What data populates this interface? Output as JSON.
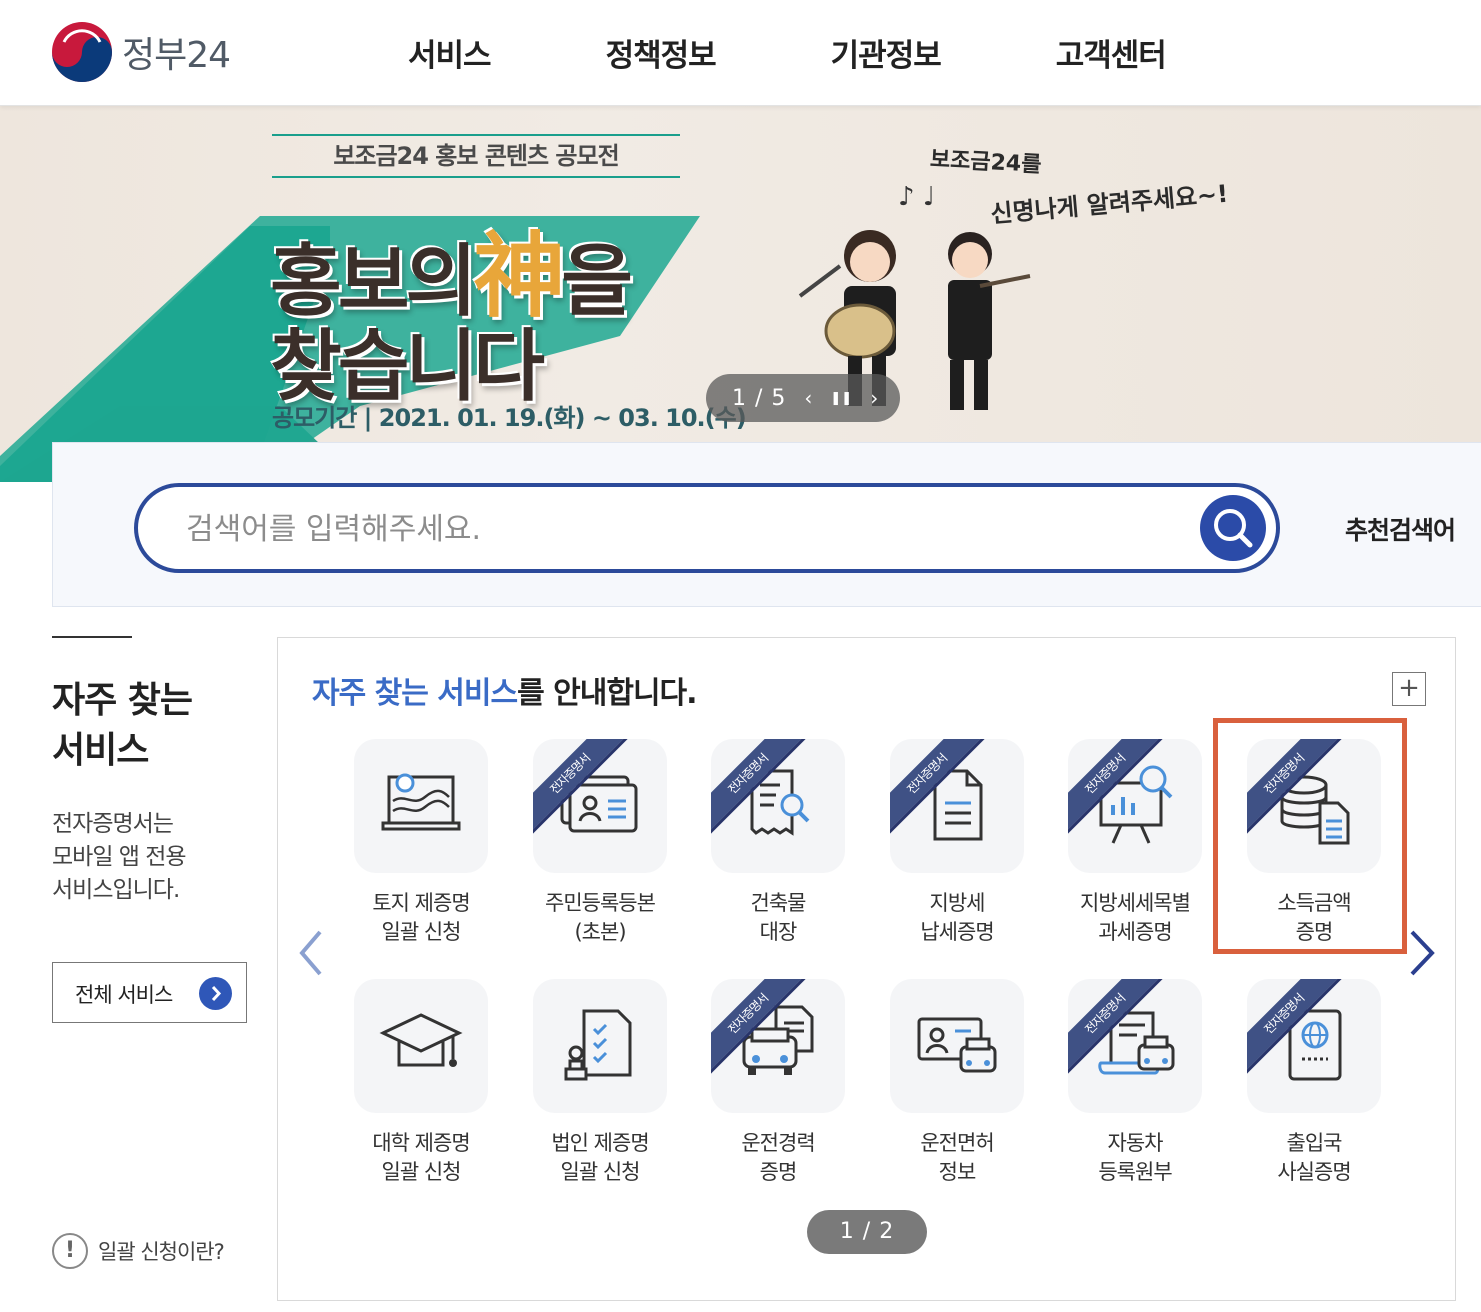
{
  "header": {
    "logo_text": "정부24",
    "nav": [
      "서비스",
      "정책정보",
      "기관정보",
      "고객센터"
    ]
  },
  "banner": {
    "subtitle": "보조금24 홍보 콘텐츠 공모전",
    "title_line1_a": "홍보의",
    "title_line1_god": "神",
    "title_line1_b": "을",
    "title_line2": "찾습니다",
    "period": "공모기간 | 2021. 01. 19.(화) ~ 03. 10.(수)",
    "tag_line1": "보조금24를",
    "tag_line2": "신명나게 알려주세요~!",
    "slide_counter": "1 / 5",
    "prev_glyph": "‹",
    "pause_glyph": "❚❚",
    "next_glyph": "›"
  },
  "search": {
    "placeholder": "검색어를 입력해주세요.",
    "recommend_label": "추천검색어"
  },
  "left": {
    "title_line1": "자주 찾는",
    "title_line2": "서비스",
    "desc_line1": "전자증명서는",
    "desc_line2": "모바일 앱 전용",
    "desc_line3": "서비스입니다.",
    "all_service_label": "전체 서비스",
    "batch_info_label": "일괄 신청이란?",
    "batch_info_glyph": "!"
  },
  "panel": {
    "title_highlight": "자주 찾는 서비스",
    "title_rest": "를 안내합니다.",
    "plus_glyph": "+",
    "ribbon_label": "전자증명서",
    "pager": "1 / 2",
    "services": [
      {
        "line1": "토지 제증명",
        "line2": "일괄 신청",
        "ribbon": false,
        "icon": "land-map-icon"
      },
      {
        "line1": "주민등록등본",
        "line2": "(초본)",
        "ribbon": true,
        "icon": "id-card-icon"
      },
      {
        "line1": "건축물",
        "line2": "대장",
        "ribbon": true,
        "icon": "building-ledger-search-icon"
      },
      {
        "line1": "지방세",
        "line2": "납세증명",
        "ribbon": true,
        "icon": "document-icon"
      },
      {
        "line1": "지방세세목별",
        "line2": "과세증명",
        "ribbon": true,
        "icon": "chart-board-search-icon"
      },
      {
        "line1": "소득금액",
        "line2": "증명",
        "ribbon": true,
        "icon": "database-document-icon"
      },
      {
        "line1": "대학 제증명",
        "line2": "일괄 신청",
        "ribbon": false,
        "icon": "graduation-cap-icon"
      },
      {
        "line1": "법인 제증명",
        "line2": "일괄 신청",
        "ribbon": false,
        "icon": "stamp-checklist-icon"
      },
      {
        "line1": "운전경력",
        "line2": "증명",
        "ribbon": true,
        "icon": "car-document-icon"
      },
      {
        "line1": "운전면허",
        "line2": "정보",
        "ribbon": false,
        "icon": "license-car-icon"
      },
      {
        "line1": "자동차",
        "line2": "등록원부",
        "ribbon": true,
        "icon": "car-scroll-icon"
      },
      {
        "line1": "출입국",
        "line2": "사실증명",
        "ribbon": true,
        "icon": "passport-icon"
      }
    ]
  },
  "colors": {
    "brand_blue": "#2b4ba8",
    "highlight_orange": "#d9603d",
    "ribbon_navy": "#3f5185",
    "banner_teal": "#1a9f8c"
  }
}
